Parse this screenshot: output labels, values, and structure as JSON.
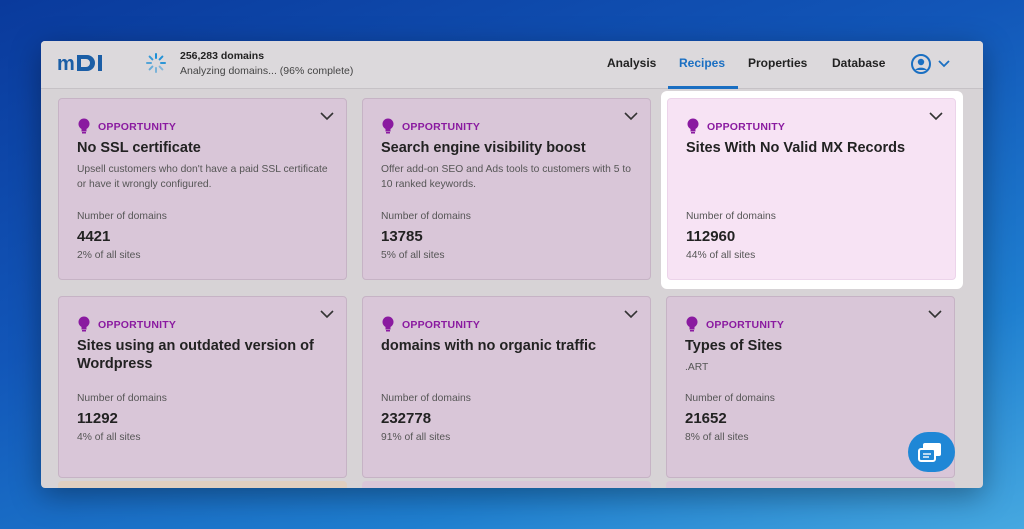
{
  "header": {
    "logo_text": "mDI",
    "domain_count": "256,283 domains",
    "status": "Analyzing domains... (96% complete)",
    "progress_percent": 96,
    "nav": [
      "Analysis",
      "Recipes",
      "Properties",
      "Database"
    ],
    "active_nav": "Recipes"
  },
  "colors": {
    "accent_blue": "#1a6fc2",
    "opportunity_purple": "#8a1aa0",
    "card_bg": "#d9c6d8",
    "highlight_card_bg": "#f7e3f4"
  },
  "cards": [
    {
      "tag": "OPPORTUNITY",
      "title": "No SSL certificate",
      "desc": "Upsell customers who don't have a paid SSL certificate or have it wrongly configured.",
      "count_label": "Number of domains",
      "count": "4421",
      "pct": "2% of all sites"
    },
    {
      "tag": "OPPORTUNITY",
      "title": "Search engine visibility boost",
      "desc": "Offer add-on SEO and Ads tools to customers with 5 to 10 ranked keywords.",
      "count_label": "Number of domains",
      "count": "13785",
      "pct": "5% of all sites"
    },
    {
      "tag": "OPPORTUNITY",
      "title": "Sites With No Valid MX Records",
      "desc": "",
      "count_label": "Number of domains",
      "count": "112960",
      "pct": "44% of all sites"
    },
    {
      "tag": "OPPORTUNITY",
      "title": "Sites using an outdated version of Wordpress",
      "desc": "",
      "count_label": "Number of domains",
      "count": "11292",
      "pct": "4% of all sites"
    },
    {
      "tag": "OPPORTUNITY",
      "title": "domains with no organic traffic",
      "desc": "",
      "count_label": "Number of domains",
      "count": "232778",
      "pct": "91% of all sites"
    },
    {
      "tag": "OPPORTUNITY",
      "title": "Types of Sites",
      "desc": ".ART",
      "count_label": "Number of domains",
      "count": "21652",
      "pct": "8% of all sites"
    }
  ],
  "icons": {
    "spinner": "loading-spinner-icon",
    "tag": "lightbulb-icon",
    "expand": "chevron-down-icon",
    "user": "user-circle-icon",
    "chat": "chat-icon"
  }
}
